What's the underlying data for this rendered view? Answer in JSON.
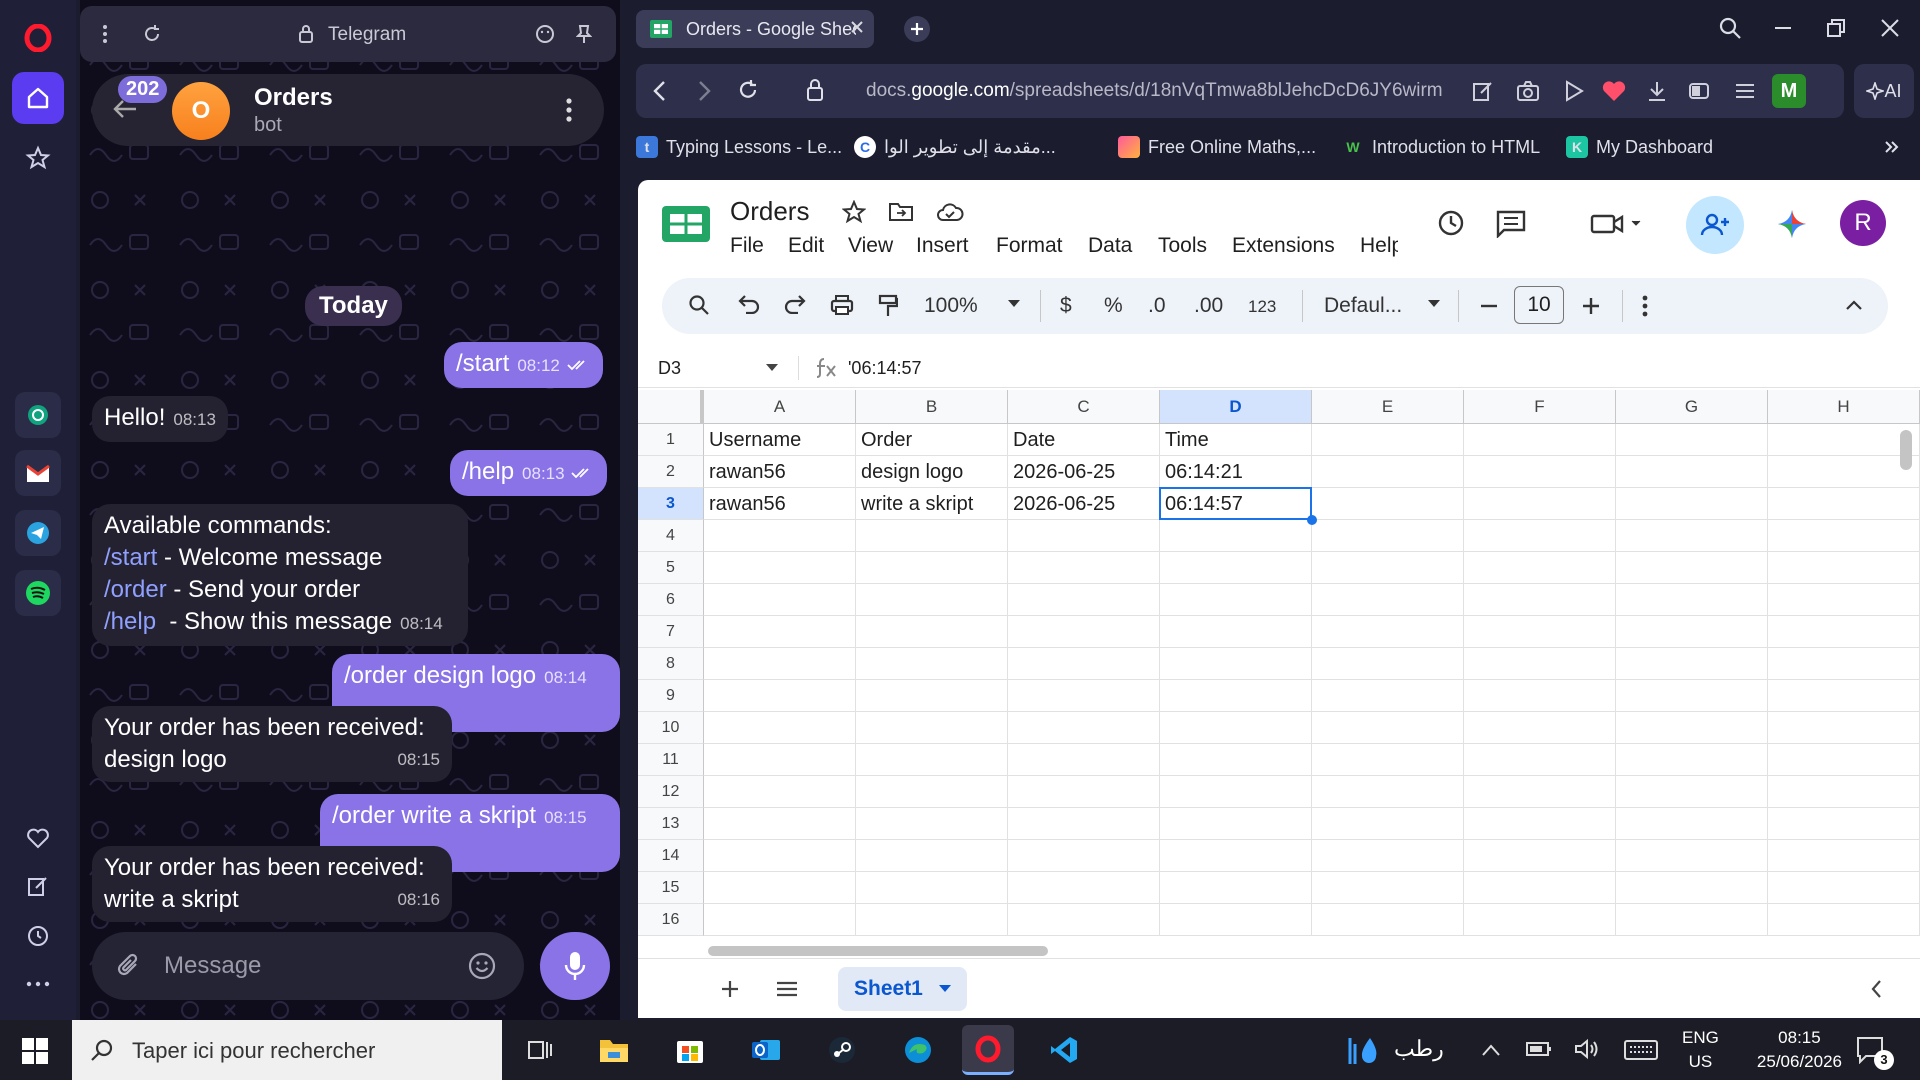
{
  "telegram": {
    "url_label": "Telegram",
    "chat_title": "Orders",
    "chat_subtitle": "bot",
    "avatar_letter": "O",
    "unread_badge": "202",
    "day_label": "Today",
    "input_placeholder": "Message",
    "messages": [
      {
        "dir": "out",
        "text": "/start",
        "time": "08:12"
      },
      {
        "dir": "in",
        "text": "Hello!",
        "time": "08:13"
      },
      {
        "dir": "out",
        "text": "/help",
        "time": "08:13"
      },
      {
        "dir": "in",
        "lines": [
          {
            "text": "Available commands:"
          },
          {
            "cmd": "/start",
            "desc": " - Welcome message"
          },
          {
            "cmd": "/order",
            "desc": " - Send your order"
          },
          {
            "cmd": "/help",
            "desc": "  - Show this message"
          }
        ],
        "time": "08:14"
      },
      {
        "dir": "out",
        "text": "/order design logo",
        "time": "08:14"
      },
      {
        "dir": "in",
        "line1": "Your order has been received:",
        "line2": "design logo",
        "time": "08:15"
      },
      {
        "dir": "out",
        "text": "/order write a skript",
        "time": "08:15"
      },
      {
        "dir": "in",
        "line1": "Your order has been received:",
        "line2": "write a skript",
        "time": "08:16"
      }
    ]
  },
  "browser": {
    "tab_title": "Orders - Google Sheets",
    "url_prefix": "docs.",
    "url_domain": "google.com",
    "url_path": "/spreadsheets/d/18nVqTmwa8blJehcDcD6JY6wirm",
    "extension_letter": "M",
    "ai_label": "AI",
    "bookmarks": [
      {
        "label": "Typing Lessons - Le..."
      },
      {
        "label": "مقدمة إلى تطوير الوا..."
      },
      {
        "label": "Free Online Maths,..."
      },
      {
        "label": "Introduction to HTML"
      },
      {
        "label": "My Dashboard"
      }
    ]
  },
  "sheets": {
    "title": "Orders",
    "menus": [
      "File",
      "Edit",
      "View",
      "Insert",
      "Format",
      "Data",
      "Tools",
      "Extensions",
      "Help"
    ],
    "zoom": "100%",
    "currency_symbol": "$",
    "percent_symbol": "%",
    "decrease_decimal": ".0",
    "increase_decimal": ".00",
    "number_format": "123",
    "font_name": "Defaul...",
    "font_size": "10",
    "user_initial": "R",
    "name_box": "D3",
    "formula_value": "'06:14:57",
    "columns": [
      "A",
      "B",
      "C",
      "D",
      "E",
      "F",
      "G",
      "H"
    ],
    "selected_column": "D",
    "selected_row": 3,
    "rows": [
      "1",
      "2",
      "3",
      "4",
      "5",
      "6",
      "7",
      "8",
      "9",
      "10",
      "11",
      "12",
      "13",
      "14",
      "15",
      "16"
    ],
    "cells": [
      [
        "Username",
        "Order",
        "Date",
        "Time"
      ],
      [
        "rawan56",
        "design logo",
        "2026-06-25",
        "06:14:21"
      ],
      [
        "rawan56",
        "write a skript",
        "2026-06-25",
        "06:14:57"
      ]
    ],
    "sheet_tab": "Sheet1"
  },
  "taskbar": {
    "search_placeholder": "Taper ici pour rechercher",
    "weather_text": "رطب",
    "lang_top": "ENG",
    "lang_bottom": "US",
    "time": "08:15",
    "date": "25/06/2026",
    "notif_count": "3"
  },
  "colors": {
    "telegram_accent": "#8a73e6",
    "sheets_green": "#0f9d58",
    "selection_blue": "#1a73e8",
    "opera_red": "#ff1b2d"
  }
}
